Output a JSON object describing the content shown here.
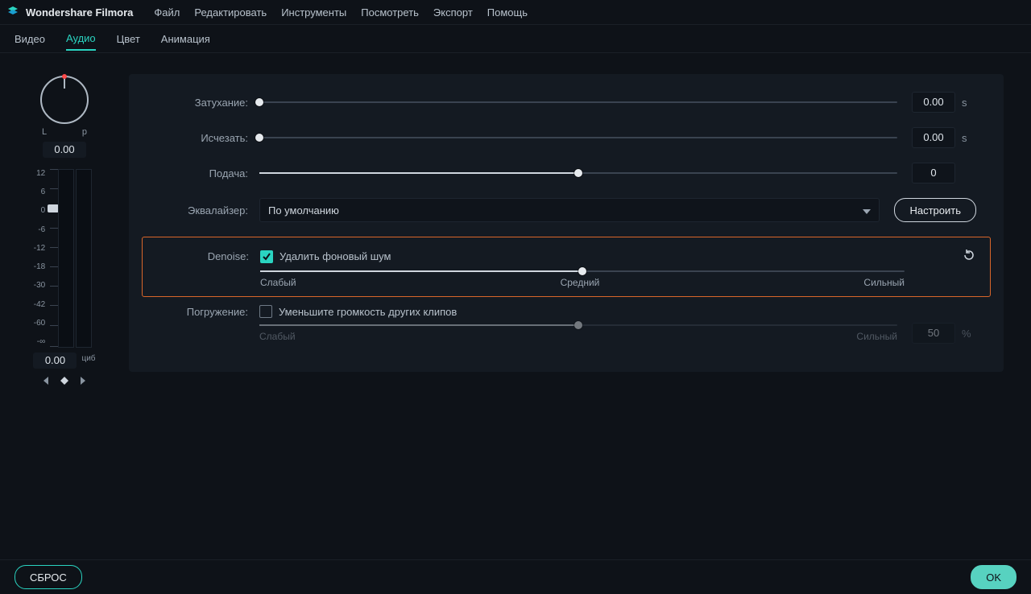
{
  "app": {
    "title": "Wondershare Filmora"
  },
  "menu": [
    "Файл",
    "Редактировать",
    "Инструменты",
    "Посмотреть",
    "Экспорт",
    "Помощь"
  ],
  "tabs": [
    "Видео",
    "Аудио",
    "Цвет",
    "Анимация"
  ],
  "activeTab": "Аудио",
  "pan": {
    "leftLabel": "L",
    "rightLabel": "р",
    "value": "0.00"
  },
  "vmeter": {
    "ticks": [
      "12",
      "6",
      "0",
      "-6",
      "-12",
      "-18",
      "-30",
      "-42",
      "-60",
      "-∞"
    ],
    "readout": "0.00",
    "unitLabel": "циб"
  },
  "rows": {
    "fadein": {
      "label": "Затухание:",
      "value": "0.00",
      "unit": "s",
      "pos": 0
    },
    "fadeout": {
      "label": "Исчезать:",
      "value": "0.00",
      "unit": "s",
      "pos": 0
    },
    "pitch": {
      "label": "Подача:",
      "value": "0",
      "unit": "",
      "pos": 50
    },
    "eq": {
      "label": "Эквалайзер:",
      "selected": "По умолчанию",
      "customize": "Настроить"
    },
    "denoise": {
      "label": "Denoise:",
      "checkbox": "Удалить фоновый шум",
      "checked": true,
      "pos": 50,
      "levels": [
        "Слабый",
        "Средний",
        "Сильный"
      ]
    },
    "ducking": {
      "label": "Погружение:",
      "checkbox": "Уменьшите громкость других клипов",
      "checked": false,
      "value": "50",
      "unit": "%",
      "pos": 50,
      "levels": [
        "Слабый",
        "Сильный"
      ]
    }
  },
  "footer": {
    "reset": "СБРОС",
    "ok": "OK"
  }
}
